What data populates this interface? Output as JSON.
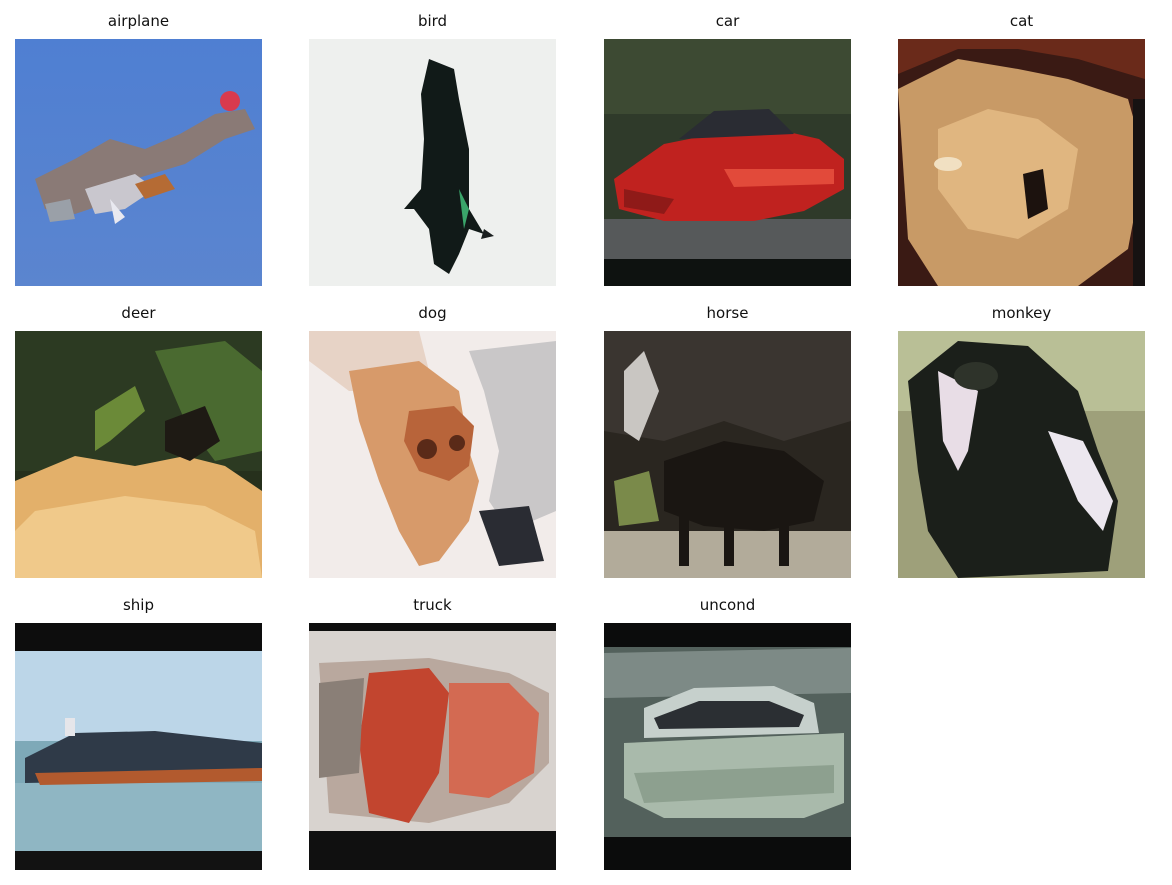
{
  "panels": [
    {
      "label": "airplane"
    },
    {
      "label": "bird"
    },
    {
      "label": "car"
    },
    {
      "label": "cat"
    },
    {
      "label": "deer"
    },
    {
      "label": "dog"
    },
    {
      "label": "horse"
    },
    {
      "label": "monkey"
    },
    {
      "label": "ship"
    },
    {
      "label": "truck"
    },
    {
      "label": "uncond"
    }
  ]
}
